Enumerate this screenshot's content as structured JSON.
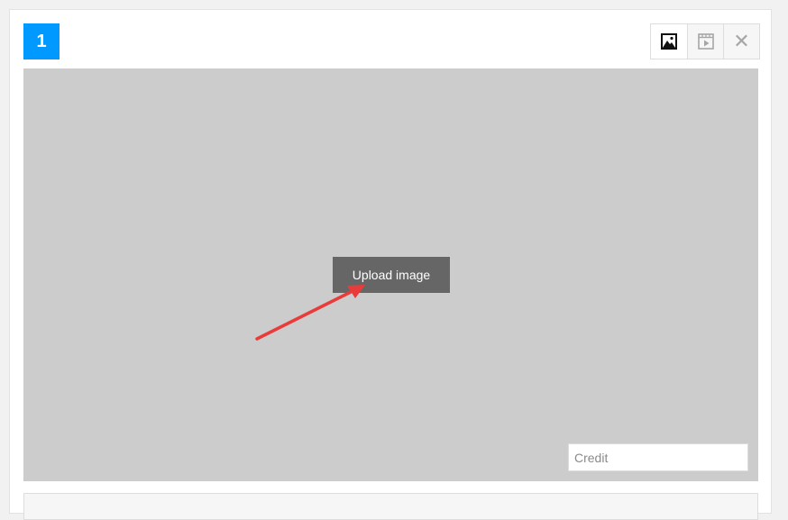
{
  "slide": {
    "number": "1"
  },
  "toolbar": {
    "image_icon": "image-icon",
    "video_icon": "video-icon",
    "close_icon": "close-icon",
    "close_glyph": "✕"
  },
  "media": {
    "upload_label": "Upload image",
    "credit_placeholder": "Credit",
    "credit_value": ""
  },
  "colors": {
    "badge_bg": "#0099ff",
    "media_bg": "#cccccc",
    "upload_btn_bg": "#666666",
    "arrow": "#ea3b3b",
    "icon_active": "#111111",
    "icon_inactive": "#a6a6a6"
  }
}
